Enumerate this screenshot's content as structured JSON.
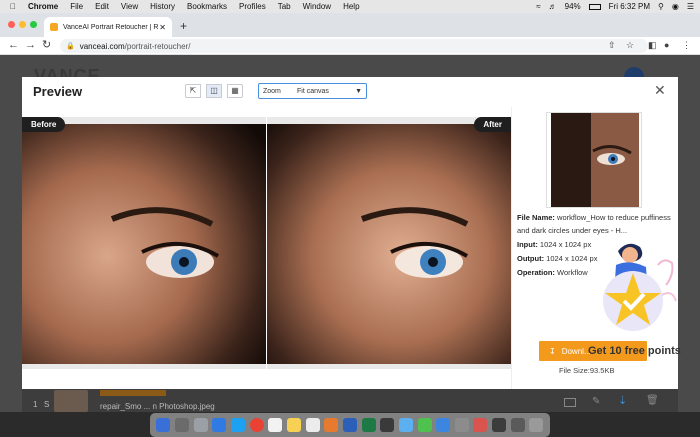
{
  "menubar": {
    "items": [
      "Chrome",
      "File",
      "Edit",
      "View",
      "History",
      "Bookmarks",
      "Profiles",
      "Tab",
      "Window",
      "Help"
    ],
    "battery": "94%",
    "clock": "Fri 6:32 PM"
  },
  "browser": {
    "tab_title": "VanceAI Portrait Retoucher | R...",
    "new_tab": "+",
    "url_host": "vanceai.com",
    "url_path": "/portrait-retoucher/"
  },
  "page_bg": {
    "logo": "VANCE",
    "row_number": "1",
    "row_label": "S",
    "row_filename": "repair_Smo ... n Photoshop.jpeg"
  },
  "modal": {
    "title": "Preview",
    "view_icons": [
      "expand-icon",
      "split-view-icon",
      "side-by-side-icon"
    ],
    "zoom_label": "Zoom",
    "zoom_value": "Fit canvas",
    "before_label": "Before",
    "after_label": "After",
    "close_symbol": "✕"
  },
  "panel": {
    "file_name_label": "File Name:",
    "file_name_value": "workflow_How to reduce puffiness and dark circles under eyes - H...",
    "input_label": "Input:",
    "input_value": "1024 x 1024 px",
    "output_label": "Output:",
    "output_value": "1024 x 1024 px",
    "operation_label": "Operation:",
    "operation_value": "Workflow",
    "download_label": "Downl...",
    "promo_text": "Get 10 free points",
    "file_size": "File Size:93.5KB"
  },
  "colors": {
    "accent_orange": "#f39a1c",
    "tag_dark": "#1f1f1f",
    "zoom_border": "#4a90e2"
  }
}
